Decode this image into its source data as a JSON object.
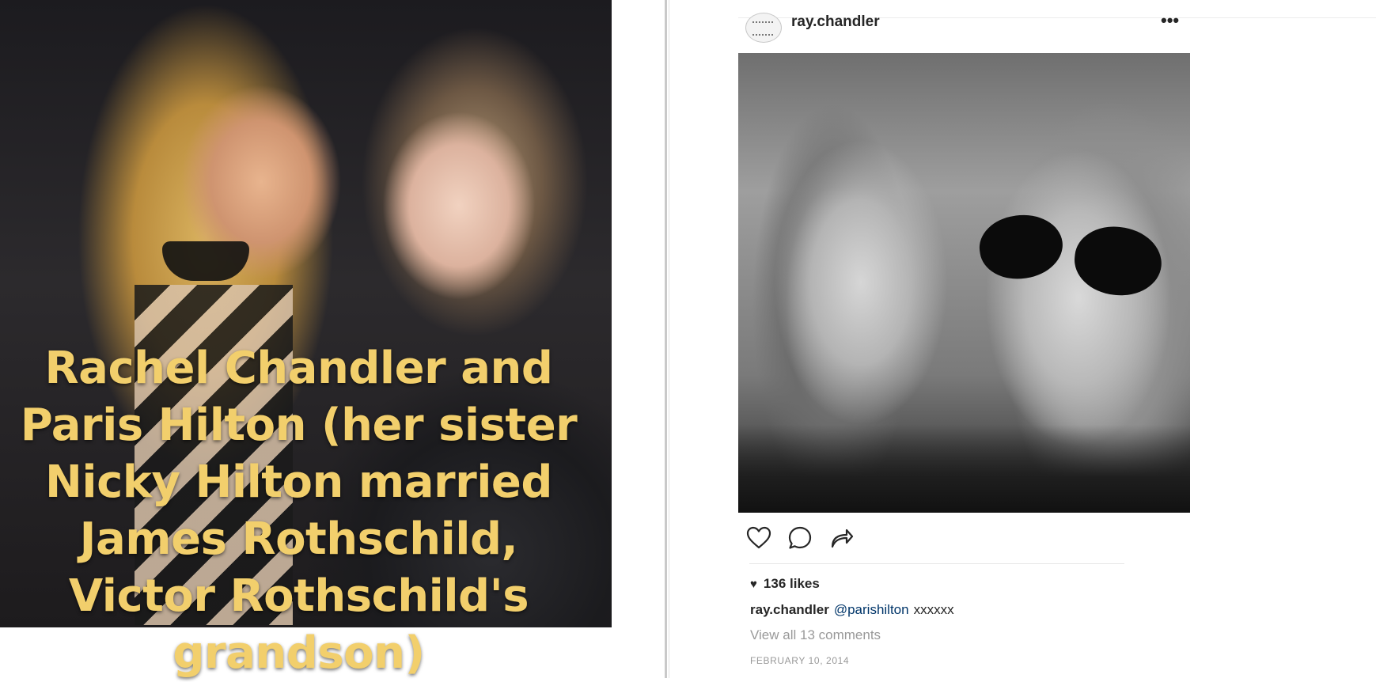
{
  "left_panel": {
    "caption": "Rachel Chandler and Paris Hilton (her sister Nicky Hilton married James Rothschild, Victor Rothschild's grandson)",
    "caption_color": "#f2cf6c"
  },
  "post": {
    "username": "ray.chandler",
    "more_icon": "more-dots-icon",
    "actions": [
      {
        "icon": "heart-icon"
      },
      {
        "icon": "comment-icon"
      },
      {
        "icon": "share-icon"
      }
    ],
    "likes": "136 likes",
    "caption_user": "ray.chandler",
    "mention": "@parishilton",
    "caption_text": "xxxxxx",
    "view_comments": "View all 13 comments",
    "date": "FEBRUARY 10, 2014",
    "mention_color": "#003569"
  }
}
